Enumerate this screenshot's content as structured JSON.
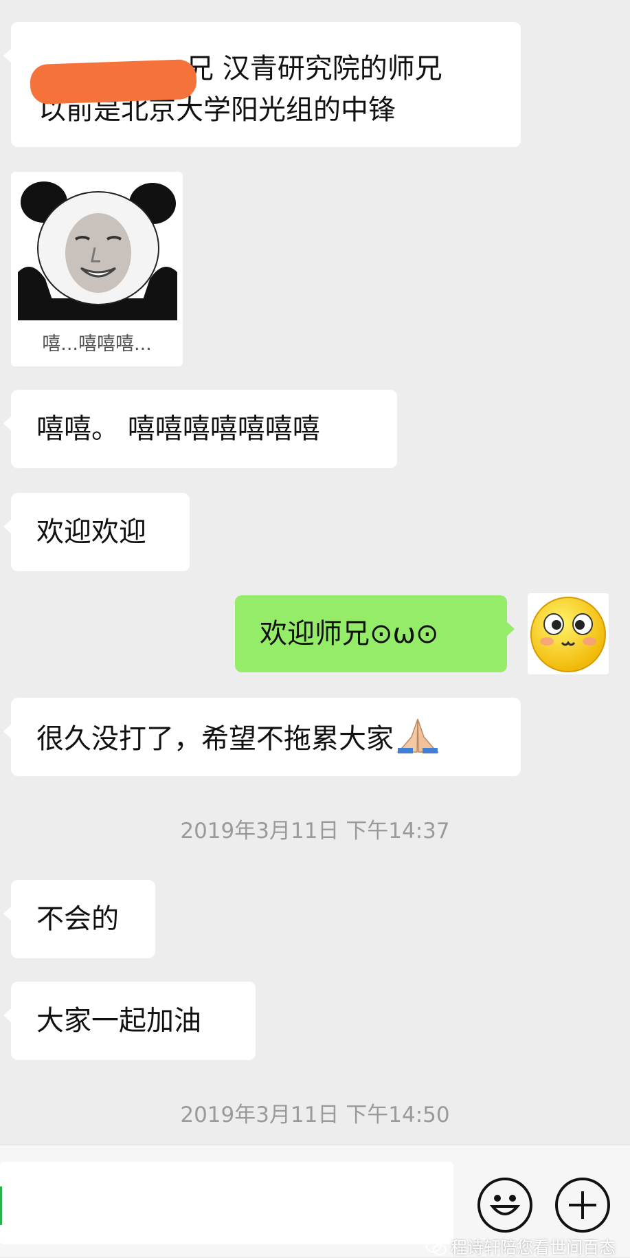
{
  "messages": [
    {
      "text_line1": "兄 汉青研究院的师兄",
      "text_line2": "以前是北京大学阳光组的中锋"
    },
    {
      "sticker_caption": "嘻...嘻嘻嘻..."
    },
    {
      "text": "嘻嘻。 嘻嘻嘻嘻嘻嘻嘻"
    },
    {
      "text": "欢迎欢迎"
    },
    {
      "text": "欢迎师兄⊙ω⊙"
    },
    {
      "text": "很久没打了，希望不拖累大家"
    },
    {
      "text": "不会的"
    },
    {
      "text": "大家一起加油"
    }
  ],
  "timestamps": [
    "2019年3月11日 下午14:37",
    "2019年3月11日 下午14:50"
  ],
  "emoji": {
    "praying_hands": "praying-hands-icon"
  },
  "input": {
    "value": ""
  },
  "watermark": {
    "text": "程诗轩陪您看世间百态"
  },
  "colors": {
    "background": "#ededed",
    "incoming_bubble": "#ffffff",
    "outgoing_bubble": "#95ec69",
    "timestamp": "#9a9a9a",
    "redaction": "#f5733a"
  }
}
